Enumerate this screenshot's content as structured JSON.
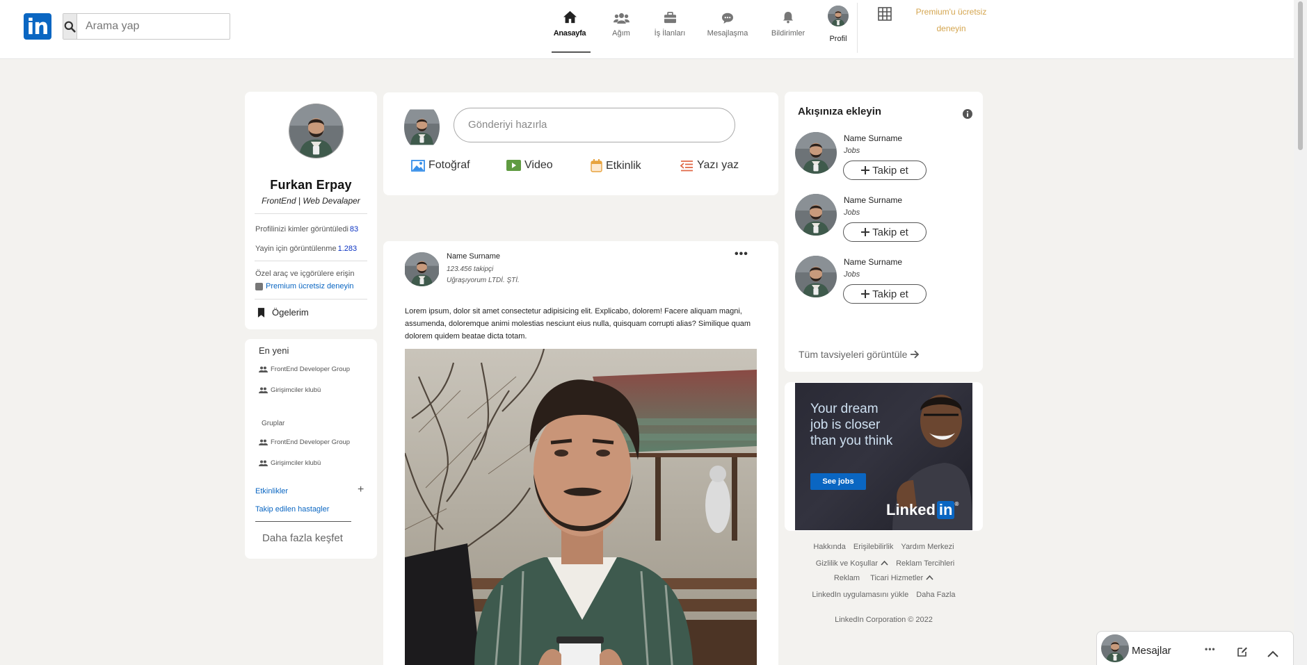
{
  "header": {
    "logo_text": "in",
    "search_placeholder": "Arama yap",
    "nav": [
      {
        "label": "Anasayfa",
        "icon": "home-icon",
        "active": true
      },
      {
        "label": "Ağım",
        "icon": "network-icon",
        "active": false
      },
      {
        "label": "İş İlanları",
        "icon": "briefcase-icon",
        "active": false
      },
      {
        "label": "Mesajlaşma",
        "icon": "messaging-icon",
        "active": false
      },
      {
        "label": "Bildirimler",
        "icon": "bell-icon",
        "active": false
      },
      {
        "label": "Profil",
        "icon": "profile-avatar",
        "active": false
      }
    ],
    "premium_line1": "Premium'u ücretsiz",
    "premium_line2": "deneyin"
  },
  "profile": {
    "name": "Furkan Erpay",
    "title": "FrontEnd | Web Devalaper",
    "stat1_label": "Profilinizi kimler görüntüledi",
    "stat1_value": "83",
    "stat2_label": "Yayin için görüntülenme",
    "stat2_value": "1.283",
    "perk_label": "Özel araç ve içgörülere erişin",
    "perk_link": "Premium ücretsiz deneyin",
    "saved_label": "Ögelerim"
  },
  "groups": {
    "recent_heading": "En yeni",
    "recent": [
      "FrontEnd Developer Group",
      "Girişimciler klubü"
    ],
    "groups_heading": "Gruplar",
    "groups": [
      "FrontEnd Developer Group",
      "Girişimciler klubü"
    ],
    "events_link": "Etkinlikler",
    "plus": "+",
    "hashtags_link": "Takip edilen hastagler",
    "discover": "Daha fazla keşfet"
  },
  "share": {
    "placeholder": "Gönderiyi hazırla",
    "actions": [
      {
        "label": "Fotoğraf",
        "icon": "photo-icon",
        "color": "#378fe9"
      },
      {
        "label": "Video",
        "icon": "video-icon",
        "color": "#5f9b41"
      },
      {
        "label": "Etkinlik",
        "icon": "calendar-icon",
        "color": "#e7a33e"
      },
      {
        "label": "Yazı yaz",
        "icon": "article-icon",
        "color": "#e06847"
      }
    ]
  },
  "post": {
    "author": "Name Surname",
    "followers": "123.456 takipçi",
    "company": "Uğraşıyorum LTDİ. ŞTİ.",
    "more": "•••",
    "body": "Lorem ipsum, dolor sit amet consectetur adipisicing elit. Explicabo, dolorem! Facere aliquam magni, assumenda, doloremque animi molestias nesciunt eius nulla, quisquam corrupti alias? Similique quam dolorem quidem beatae dicta totam."
  },
  "feed": {
    "title": "Akışınıza ekleyin",
    "suggestions": [
      {
        "name": "Name Surname",
        "role": "Jobs",
        "button": "Takip et"
      },
      {
        "name": "Name Surname",
        "role": "Jobs",
        "button": "Takip et"
      },
      {
        "name": "Name Surname",
        "role": "Jobs",
        "button": "Takip et"
      }
    ],
    "all_recs": "Tüm tavsiyeleri görüntüle"
  },
  "ad": {
    "headline": "Your dream job is closer than you think",
    "button": "See jobs",
    "brand_a": "Linked",
    "brand_b": "in",
    "brand_mark": "®"
  },
  "footer": {
    "links": [
      "Hakkında",
      "Erişilebilirlik",
      "Yardım Merkezi",
      "Gizlilik ve Koşullar",
      "Reklam Tercihleri",
      "Reklam",
      "Ticari Hizmetler",
      "LinkedIn uygulamasını yükle",
      "Daha Fazla"
    ],
    "copyright": "LinkedIn Corporation © 2022"
  },
  "messaging": {
    "label": "Mesajlar",
    "more": "•••"
  },
  "colors": {
    "brand": "#0a66c2",
    "premium": "#d4a54f",
    "background": "#f3f2ef"
  }
}
